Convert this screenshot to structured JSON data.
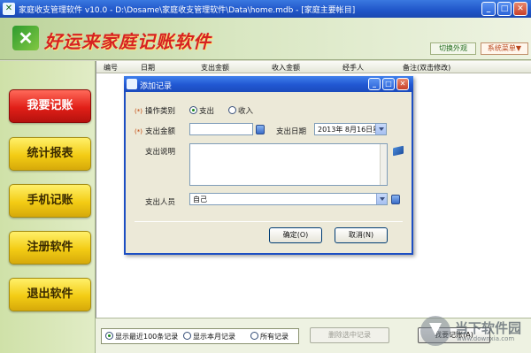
{
  "window": {
    "title": "家庭收支管理软件 v10.0 - D:\\Dosame\\家庭收支管理软件\\Data\\home.mdb - [家庭主要帐目]",
    "icon": "app-icon"
  },
  "banner": {
    "brand": "好运来家庭记账软件",
    "skin_button": "切换外观",
    "menu_button": "系统菜单▼"
  },
  "sidebar": {
    "items": [
      {
        "label": "我要记账",
        "active": true
      },
      {
        "label": "统计报表",
        "active": false
      },
      {
        "label": "手机记账",
        "active": false
      },
      {
        "label": "注册软件",
        "active": false
      },
      {
        "label": "退出软件",
        "active": false
      }
    ]
  },
  "table": {
    "columns": [
      "编号",
      "日期",
      "支出金额",
      "收入金额",
      "经手人",
      "备注(双击修改)"
    ]
  },
  "bottom": {
    "radios": [
      {
        "label": "显示最近100条记录",
        "checked": true
      },
      {
        "label": "显示本月记录",
        "checked": false
      },
      {
        "label": "所有记录",
        "checked": false
      }
    ],
    "delete_button": "删除选中记录",
    "add_button": "我要记账(A)"
  },
  "dialog": {
    "title": "添加记录",
    "op_type_label": "操作类别",
    "op_options": [
      {
        "label": "支出",
        "checked": true
      },
      {
        "label": "收入",
        "checked": false
      }
    ],
    "amount_label": "支出金额",
    "amount_value": "",
    "date_label": "支出日期",
    "date_value": "2013年 8月16日星",
    "desc_label": "支出说明",
    "desc_value": "",
    "person_label": "支出人员",
    "person_value": "自己",
    "ok_button": "确定(O)",
    "cancel_button": "取消(N)"
  },
  "watermark": {
    "text": "当下软件园",
    "sub": "www.downxia.com"
  },
  "colors": {
    "titlebar": "#2157d2",
    "brand": "#d62222",
    "active_sidebar": "#e11f18",
    "sidebar_button": "#f3cc14"
  }
}
